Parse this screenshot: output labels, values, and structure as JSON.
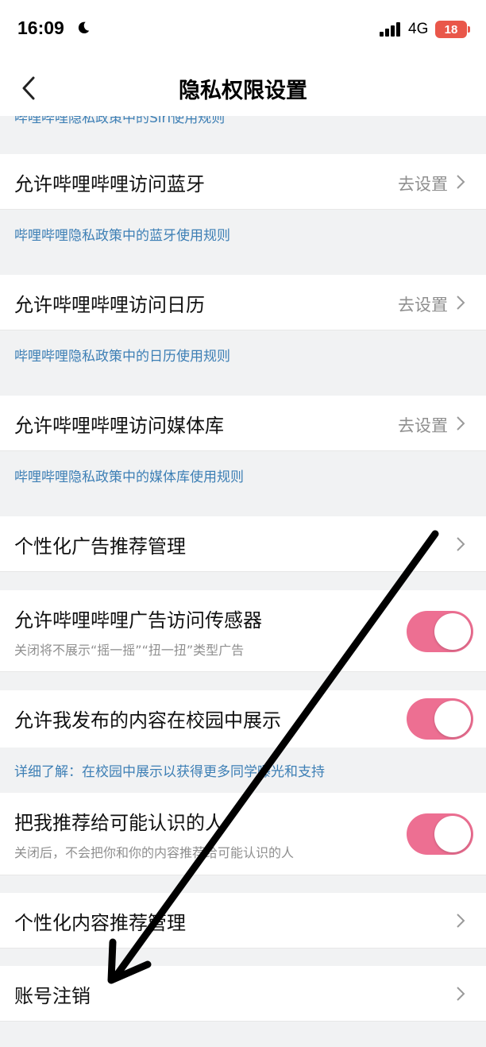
{
  "status": {
    "time": "16:09",
    "network": "4G",
    "battery": "18"
  },
  "nav": {
    "title": "隐私权限设置"
  },
  "partial_note": "哔哩哔哩隐私政策中的Siri使用规则",
  "permissions": [
    {
      "title": "允许哔哩哔哩访问蓝牙",
      "action": "去设置",
      "note": "哔哩哔哩隐私政策中的蓝牙使用规则"
    },
    {
      "title": "允许哔哩哔哩访问日历",
      "action": "去设置",
      "note": "哔哩哔哩隐私政策中的日历使用规则"
    },
    {
      "title": "允许哔哩哔哩访问媒体库",
      "action": "去设置",
      "note": "哔哩哔哩隐私政策中的媒体库使用规则"
    }
  ],
  "ad_manage": {
    "title": "个性化广告推荐管理"
  },
  "ad_sensor": {
    "title": "允许哔哩哔哩广告访问传感器",
    "subtitle": "关闭将不展示“摇一摇”“扭一扭”类型广告",
    "enabled": true
  },
  "campus": {
    "title": "允许我发布的内容在校园中展示",
    "note": "详细了解：在校园中展示以获得更多同学曝光和支持",
    "enabled": true
  },
  "recommend_me": {
    "title": "把我推荐给可能认识的人",
    "subtitle": "关闭后，不会把你和你的内容推荐给可能认识的人",
    "enabled": true
  },
  "content_manage": {
    "title": "个性化内容推荐管理"
  },
  "account_cancel": {
    "title": "账号注销"
  },
  "colors": {
    "toggle_on": "#ed6f92",
    "link": "#3d7fb5"
  }
}
